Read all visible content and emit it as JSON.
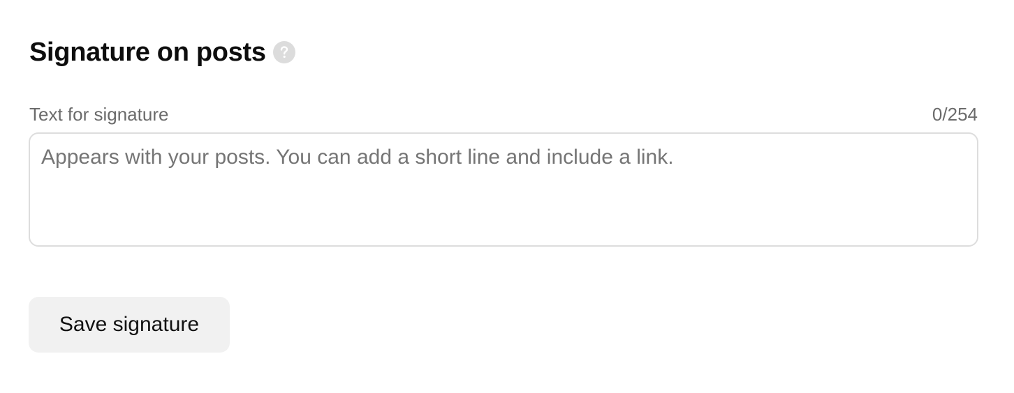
{
  "section": {
    "title": "Signature on posts",
    "help_icon": "question-circle-icon"
  },
  "signature_field": {
    "label": "Text for signature",
    "counter": "0/254",
    "value": "",
    "placeholder": "Appears with your posts. You can add a short line and include a link."
  },
  "actions": {
    "save_label": "Save signature"
  },
  "colors": {
    "help_icon_bg": "#dcdcdc",
    "button_bg": "#f1f1f1",
    "border": "#dddddd",
    "muted_text": "#6b6b6b"
  }
}
